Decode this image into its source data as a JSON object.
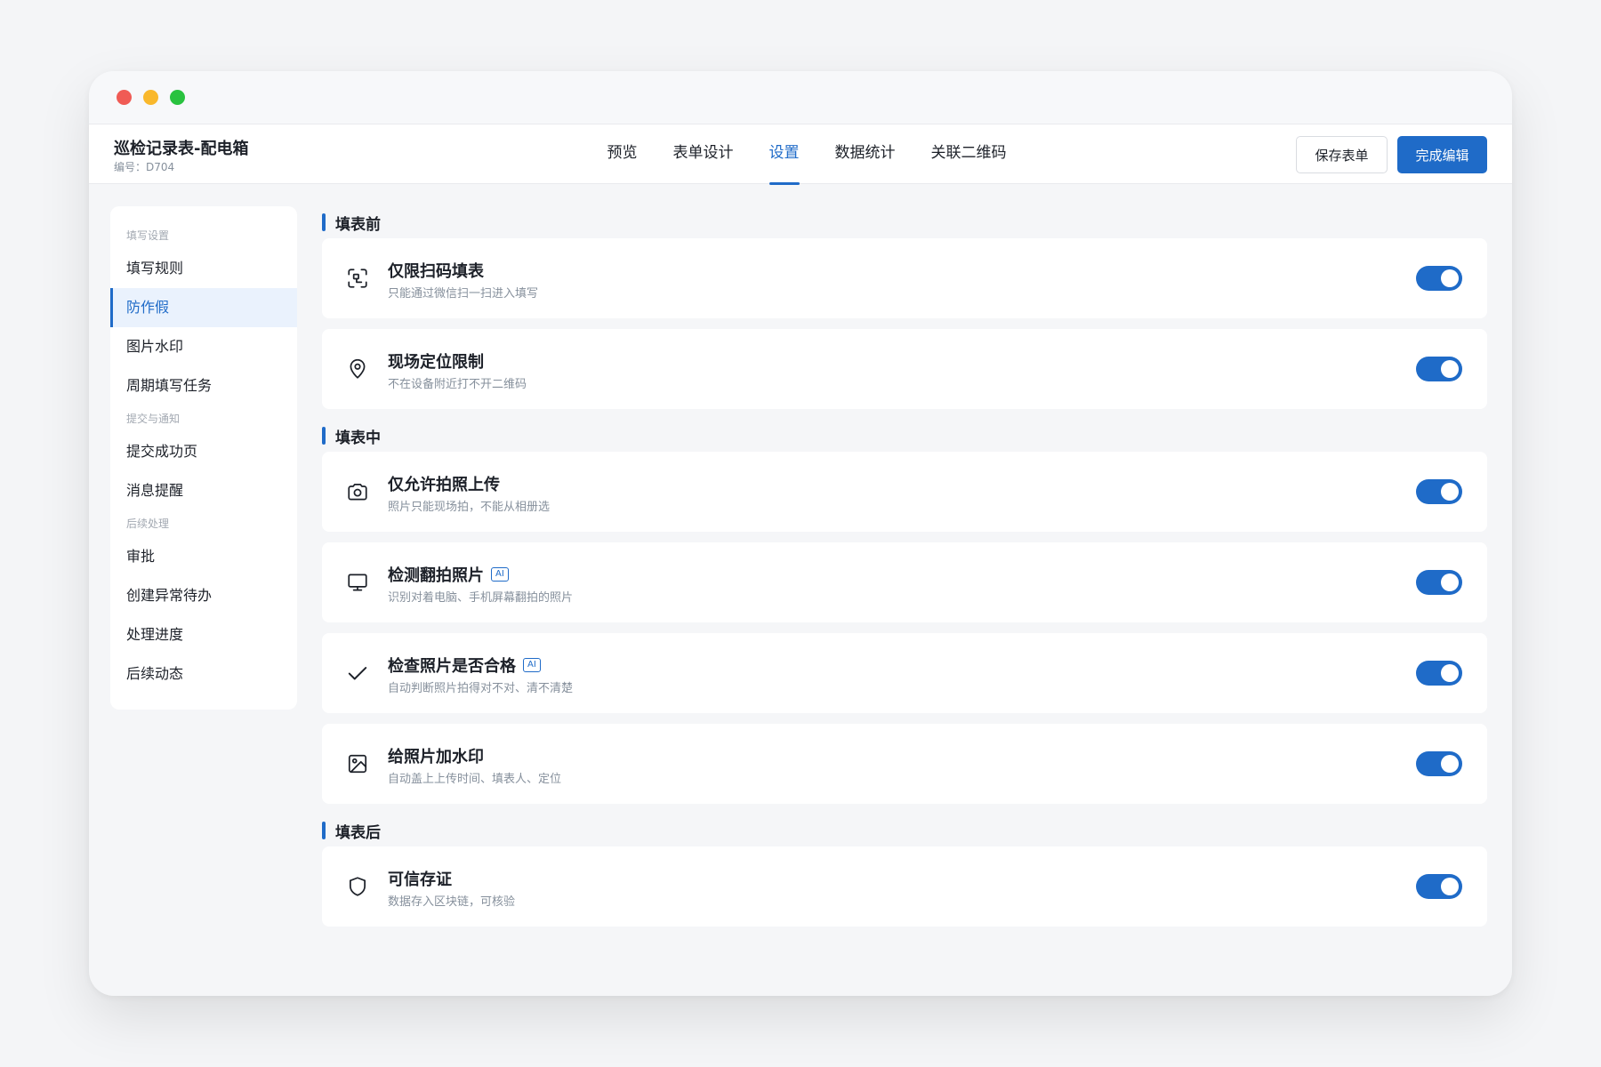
{
  "header": {
    "form_title": "巡检记录表-配电箱",
    "form_code": "编号：D704",
    "tabs": [
      {
        "label": "预览",
        "active": false
      },
      {
        "label": "表单设计",
        "active": false
      },
      {
        "label": "设置",
        "active": true
      },
      {
        "label": "数据统计",
        "active": false
      },
      {
        "label": "关联二维码",
        "active": false
      }
    ],
    "save_label": "保存表单",
    "done_label": "完成编辑"
  },
  "sidebar": {
    "groups": [
      {
        "title": "填写设置",
        "items": [
          "填写规则",
          "防作假",
          "图片水印",
          "周期填写任务"
        ]
      },
      {
        "title": "提交与通知",
        "items": [
          "提交成功页",
          "消息提醒"
        ]
      },
      {
        "title": "后续处理",
        "items": [
          "审批",
          "创建异常待办",
          "处理进度",
          "后续动态"
        ]
      }
    ],
    "active_item": "防作假"
  },
  "sections": [
    {
      "title": "填表前",
      "cards": [
        {
          "icon": "scan-icon",
          "title": "仅限扫码填表",
          "desc": "只能通过微信扫一扫进入填写",
          "ai": false,
          "enabled": true
        },
        {
          "icon": "location-pin-icon",
          "title": "现场定位限制",
          "desc": "不在设备附近打不开二维码",
          "ai": false,
          "enabled": true
        }
      ]
    },
    {
      "title": "填表中",
      "cards": [
        {
          "icon": "camera-icon",
          "title": "仅允许拍照上传",
          "desc": "照片只能现场拍，不能从相册选",
          "ai": false,
          "enabled": true
        },
        {
          "icon": "monitor-icon",
          "title": "检测翻拍照片",
          "desc": "识别对着电脑、手机屏幕翻拍的照片",
          "ai": true,
          "enabled": true
        },
        {
          "icon": "check-icon",
          "title": "检查照片是否合格",
          "desc": "自动判断照片拍得对不对、清不清楚",
          "ai": true,
          "enabled": true
        },
        {
          "icon": "image-icon",
          "title": "给照片加水印",
          "desc": "自动盖上上传时间、填表人、定位",
          "ai": false,
          "enabled": true
        }
      ]
    },
    {
      "title": "填表后",
      "cards": [
        {
          "icon": "shield-icon",
          "title": "可信存证",
          "desc": "数据存入区块链，可核验",
          "ai": false,
          "enabled": true
        }
      ]
    }
  ],
  "ai_badge_label": "AI",
  "colors": {
    "accent": "#1f6bc8",
    "window_red": "#f05b55",
    "window_yellow": "#f9b82c",
    "window_green": "#29c23f"
  }
}
